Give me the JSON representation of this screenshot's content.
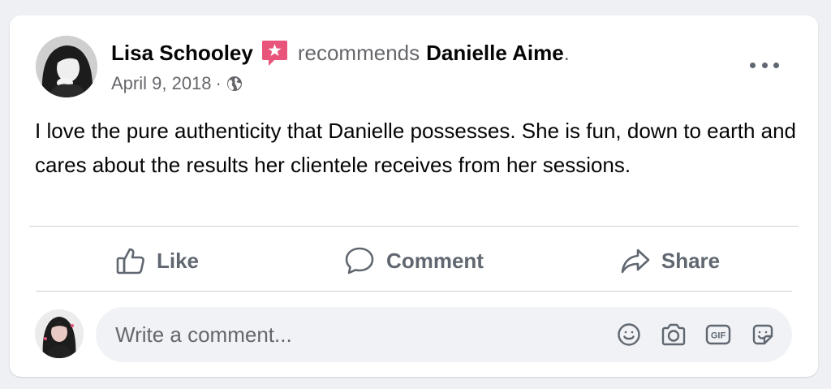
{
  "post": {
    "author": "Lisa Schooley",
    "action_text": "recommends",
    "page_name": "Danielle Aime",
    "period": ".",
    "date": "April 9, 2018",
    "separator": "·",
    "privacy_icon": "globe-icon",
    "body": "I love the pure authenticity that Danielle possesses.  She is fun, down to earth and cares about the results her clientele receives from her sessions."
  },
  "actions": {
    "like_label": "Like",
    "comment_label": "Comment",
    "share_label": "Share"
  },
  "comment_box": {
    "placeholder": "Write a comment..."
  },
  "icons": {
    "recommend": "recommendation-star-icon",
    "more": "more-options-icon",
    "like": "thumbs-up-icon",
    "comment": "speech-bubble-icon",
    "share": "share-arrow-icon",
    "emoji": "emoji-icon",
    "camera": "camera-icon",
    "gif": "gif-icon",
    "sticker": "sticker-icon"
  },
  "colors": {
    "recommend_badge": "#e8547a",
    "secondary_text": "#65676b",
    "action_text": "#606770",
    "divider": "#ced0d4",
    "comment_bg": "#f0f2f5"
  }
}
